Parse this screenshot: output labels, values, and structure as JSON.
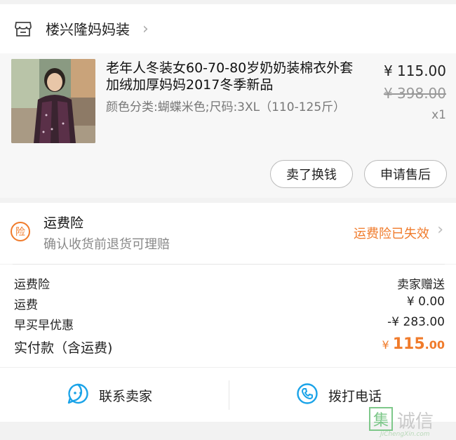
{
  "shop": {
    "name": "楼兴隆妈妈装",
    "icon": "store-icon"
  },
  "product": {
    "title": "老年人冬装女60-70-80岁奶奶装棉衣外套加绒加厚妈妈2017冬季新品",
    "spec": "颜色分类:蝴蝶米色;尺码:3XL（110-125斤）",
    "price": "¥ 115.00",
    "original_price": "¥ 398.00",
    "quantity": "x1",
    "image": "product-photo"
  },
  "actions": {
    "sell_label": "卖了换钱",
    "after_sale_label": "申请售后"
  },
  "insurance": {
    "icon_text": "险",
    "title": "运费险",
    "description": "确认收货前退货可理赔",
    "status": "运费险已失效"
  },
  "fees": {
    "rows": [
      {
        "label": "运费险",
        "value": "卖家赠送"
      },
      {
        "label": "运费",
        "value": "¥ 0.00"
      },
      {
        "label": "早买早优惠",
        "value": "-¥ 283.00"
      }
    ],
    "total_label": "实付款（含运费)",
    "total_currency": "¥",
    "total_int": "115",
    "total_dec": ".00"
  },
  "contact": {
    "seller_label": "联系卖家",
    "call_label": "拨打电话"
  },
  "watermark": {
    "box_char": "集",
    "text": "诚信",
    "url": "JiChengXin.com"
  },
  "colors": {
    "accent": "#f07b2b",
    "icon_blue": "#1aa3e8"
  }
}
